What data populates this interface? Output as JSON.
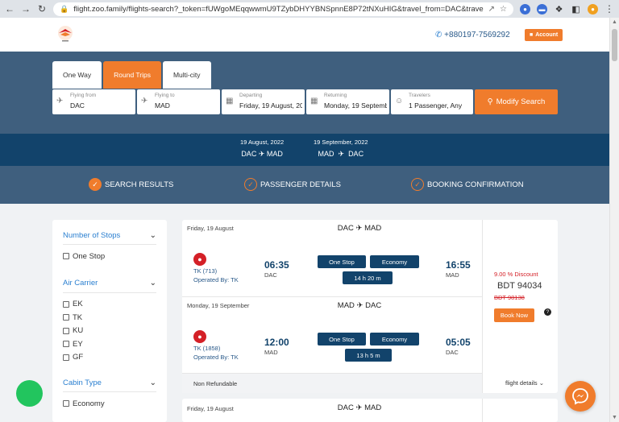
{
  "browser": {
    "url": "flight.zoo.family/flights-search?_token=fUWgoMEqqwwmU9TZybDHYYBNSpnnE8P72tNXuHIG&travel_from=DAC&travel_t..."
  },
  "header": {
    "phone": "+880197-7569292",
    "account_label": "Account"
  },
  "search": {
    "tabs": [
      {
        "label": "One Way"
      },
      {
        "label": "Round Trips"
      },
      {
        "label": "Multi-city"
      }
    ],
    "flying_from": {
      "label": "Flying from",
      "value": "DAC"
    },
    "flying_to": {
      "label": "Flying to",
      "value": "MAD"
    },
    "departing": {
      "label": "Departing",
      "value": "Friday, 19 August, 20"
    },
    "returning": {
      "label": "Returning",
      "value": "Monday, 19 Septemb"
    },
    "travelers": {
      "label": "Travelers",
      "value": "1 Passenger, Any"
    },
    "modify_label": "Modify Search"
  },
  "route_summary": {
    "outbound": {
      "date": "19 August, 2022",
      "from": "DAC",
      "to": "MAD"
    },
    "return": {
      "date": "19 September, 2022",
      "from": "MAD",
      "to": "DAC"
    }
  },
  "steps": [
    {
      "label": "SEARCH RESULTS"
    },
    {
      "label": "PASSENGER DETAILS"
    },
    {
      "label": "BOOKING CONFIRMATION"
    }
  ],
  "filters": {
    "stops": {
      "title": "Number of Stops",
      "options": [
        "One Stop"
      ]
    },
    "carrier": {
      "title": "Air Carrier",
      "options": [
        "EK",
        "TK",
        "KU",
        "EY",
        "GF"
      ]
    },
    "cabin": {
      "title": "Cabin Type",
      "options": [
        "Economy"
      ]
    }
  },
  "result": {
    "legs": [
      {
        "date": "Friday, 19 August",
        "from": "DAC",
        "to": "MAD",
        "flight_no": "TK (713)",
        "operated_by": "Operated By: TK",
        "dep_time": "06:35",
        "dep_code": "DAC",
        "arr_time": "16:55",
        "arr_code": "MAD",
        "stops": "One Stop",
        "cabin": "Economy",
        "duration": "14 h 20 m"
      },
      {
        "date": "Monday, 19 September",
        "from": "MAD",
        "to": "DAC",
        "flight_no": "TK (1858)",
        "operated_by": "Operated By: TK",
        "dep_time": "12:00",
        "dep_code": "MAD",
        "arr_time": "05:05",
        "arr_code": "DAC",
        "stops": "One Stop",
        "cabin": "Economy",
        "duration": "13 h 5 m"
      }
    ],
    "refund_note": "Non Refundable",
    "discount": "9.00 % Discount",
    "price": "BDT 94034",
    "old_price": "BDT 98138",
    "book_label": "Book Now",
    "details_label": "flight details"
  },
  "next_result": {
    "date": "Friday, 19 August",
    "from": "DAC",
    "to": "MAD"
  },
  "colors": {
    "accent": "#f07c2c",
    "navy": "#12436b",
    "panel": "#3f5f7e"
  }
}
